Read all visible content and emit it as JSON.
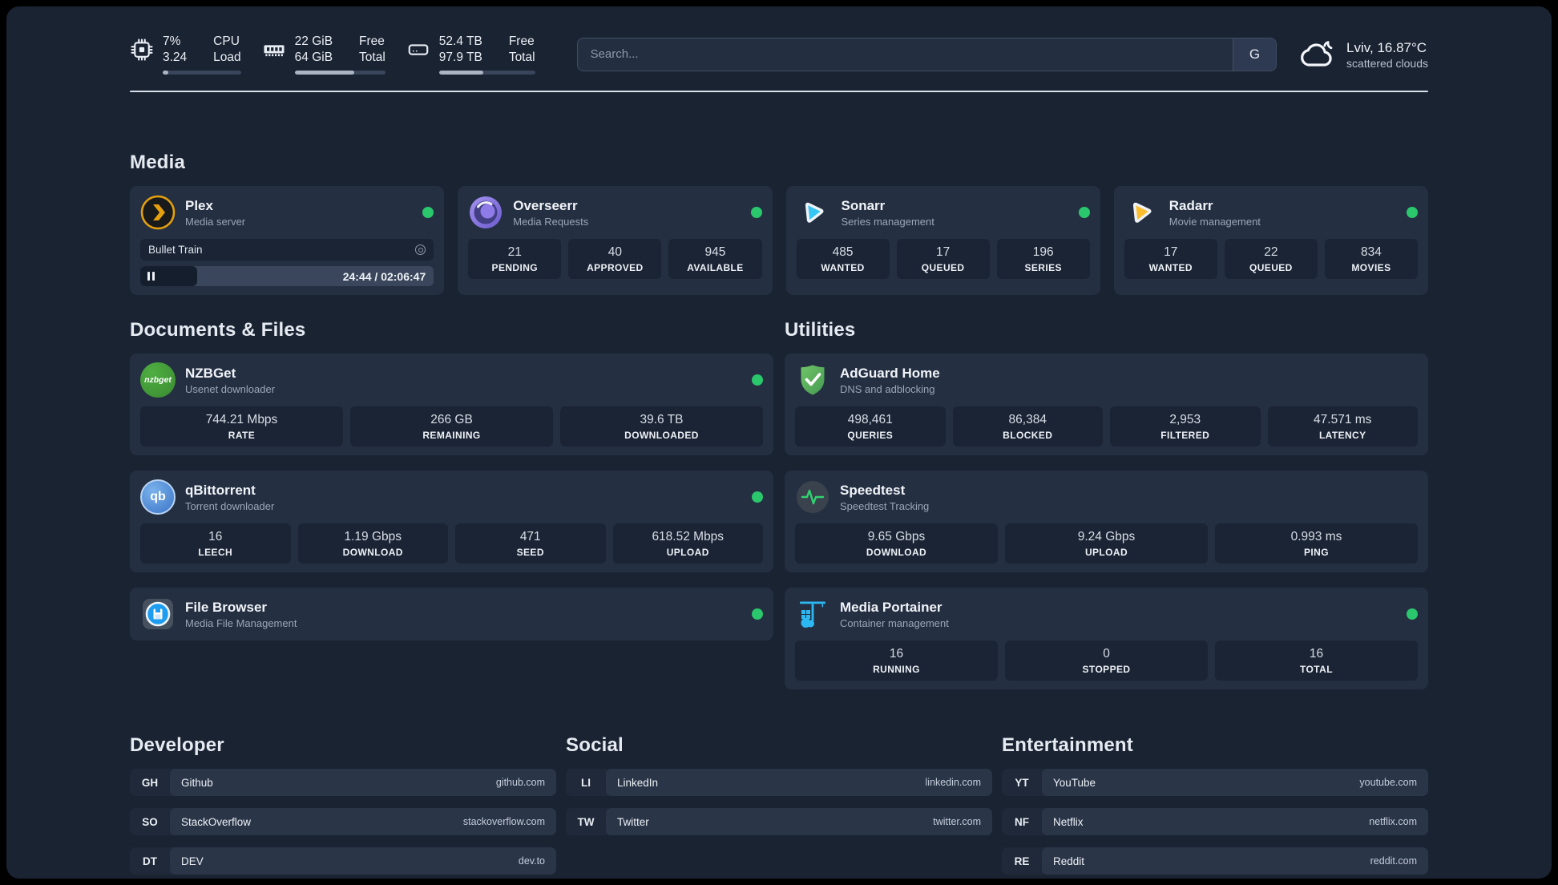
{
  "colors": {
    "page_bg": "#1a2332",
    "card_bg": "#242f42",
    "stat_bg": "#1b2434",
    "status_online": "#2bc76c",
    "plex_orange": "#e5a00d",
    "sonarr_blue": "#36c6f4",
    "radarr_yellow": "#fcbe2d",
    "adguard_green": "#5bb35d",
    "portainer_blue": "#2db8f1",
    "speedtest_pulse": "#30d46f"
  },
  "header": {
    "stats": [
      {
        "icon": "cpu-icon",
        "value1": "7%",
        "value2": "3.24",
        "label1": "CPU",
        "label2": "Load",
        "progress": 7
      },
      {
        "icon": "memory-icon",
        "value1": "22 GiB",
        "value2": "64 GiB",
        "label1": "Free",
        "label2": "Total",
        "progress": 66
      },
      {
        "icon": "disk-icon",
        "value1": "52.4 TB",
        "value2": "97.9 TB",
        "label1": "Free",
        "label2": "Total",
        "progress": 46
      }
    ],
    "search": {
      "placeholder": "Search...",
      "engine": "G"
    },
    "weather": {
      "location": "Lviv, 16.87°C",
      "condition": "scattered clouds"
    }
  },
  "icons": {
    "nzbget_logo_text": "nzbget",
    "qbittorrent_logo_text": "qb"
  },
  "sections": {
    "media": {
      "title": "Media",
      "apps": [
        {
          "name": "Plex",
          "subtitle": "Media server",
          "status": "online",
          "now_playing": {
            "title": "Bullet Train",
            "time_display": "24:44 / 02:06:47",
            "progress": 19.5
          }
        },
        {
          "name": "Overseerr",
          "subtitle": "Media Requests",
          "status": "online",
          "stats": [
            {
              "value": "21",
              "label": "PENDING"
            },
            {
              "value": "40",
              "label": "APPROVED"
            },
            {
              "value": "945",
              "label": "AVAILABLE"
            }
          ]
        },
        {
          "name": "Sonarr",
          "subtitle": "Series management",
          "status": "online",
          "stats": [
            {
              "value": "485",
              "label": "WANTED"
            },
            {
              "value": "17",
              "label": "QUEUED"
            },
            {
              "value": "196",
              "label": "SERIES"
            }
          ]
        },
        {
          "name": "Radarr",
          "subtitle": "Movie management",
          "status": "online",
          "stats": [
            {
              "value": "17",
              "label": "WANTED"
            },
            {
              "value": "22",
              "label": "QUEUED"
            },
            {
              "value": "834",
              "label": "MOVIES"
            }
          ]
        }
      ]
    },
    "documents": {
      "title": "Documents & Files",
      "apps": [
        {
          "name": "NZBGet",
          "subtitle": "Usenet downloader",
          "status": "online",
          "stats": [
            {
              "value": "744.21 Mbps",
              "label": "RATE"
            },
            {
              "value": "266 GB",
              "label": "REMAINING"
            },
            {
              "value": "39.6 TB",
              "label": "DOWNLOADED"
            }
          ]
        },
        {
          "name": "qBittorrent",
          "subtitle": "Torrent downloader",
          "status": "online",
          "stats": [
            {
              "value": "16",
              "label": "LEECH"
            },
            {
              "value": "1.19 Gbps",
              "label": "DOWNLOAD"
            },
            {
              "value": "471",
              "label": "SEED"
            },
            {
              "value": "618.52 Mbps",
              "label": "UPLOAD"
            }
          ]
        },
        {
          "name": "File Browser",
          "subtitle": "Media File Management",
          "status": "online"
        }
      ]
    },
    "utilities": {
      "title": "Utilities",
      "apps": [
        {
          "name": "AdGuard Home",
          "subtitle": "DNS and adblocking",
          "stats": [
            {
              "value": "498,461",
              "label": "QUERIES"
            },
            {
              "value": "86,384",
              "label": "BLOCKED"
            },
            {
              "value": "2,953",
              "label": "FILTERED"
            },
            {
              "value": "47.571 ms",
              "label": "LATENCY"
            }
          ]
        },
        {
          "name": "Speedtest",
          "subtitle": "Speedtest Tracking",
          "stats": [
            {
              "value": "9.65 Gbps",
              "label": "DOWNLOAD"
            },
            {
              "value": "9.24 Gbps",
              "label": "UPLOAD"
            },
            {
              "value": "0.993 ms",
              "label": "PING"
            }
          ]
        },
        {
          "name": "Media Portainer",
          "subtitle": "Container management",
          "status": "online",
          "stats": [
            {
              "value": "16",
              "label": "RUNNING"
            },
            {
              "value": "0",
              "label": "STOPPED"
            },
            {
              "value": "16",
              "label": "TOTAL"
            }
          ]
        }
      ]
    },
    "bookmarks": [
      {
        "title": "Developer",
        "links": [
          {
            "abbr": "GH",
            "name": "Github",
            "domain": "github.com"
          },
          {
            "abbr": "SO",
            "name": "StackOverflow",
            "domain": "stackoverflow.com"
          },
          {
            "abbr": "DT",
            "name": "DEV",
            "domain": "dev.to"
          }
        ]
      },
      {
        "title": "Social",
        "links": [
          {
            "abbr": "LI",
            "name": "LinkedIn",
            "domain": "linkedin.com"
          },
          {
            "abbr": "TW",
            "name": "Twitter",
            "domain": "twitter.com"
          }
        ]
      },
      {
        "title": "Entertainment",
        "links": [
          {
            "abbr": "YT",
            "name": "YouTube",
            "domain": "youtube.com"
          },
          {
            "abbr": "NF",
            "name": "Netflix",
            "domain": "netflix.com"
          },
          {
            "abbr": "RE",
            "name": "Reddit",
            "domain": "reddit.com"
          }
        ]
      }
    ]
  }
}
